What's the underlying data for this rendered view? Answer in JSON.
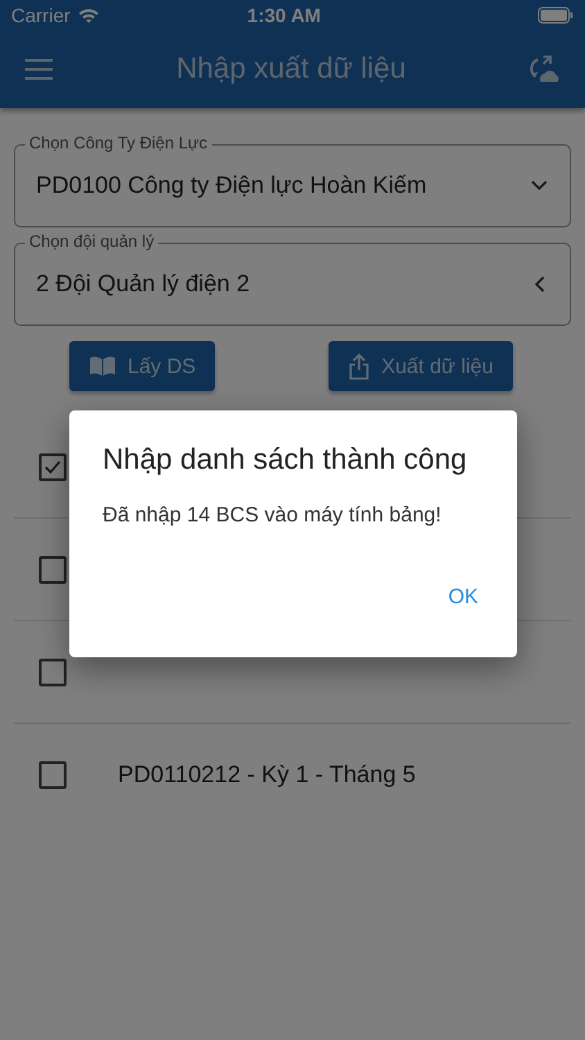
{
  "status_bar": {
    "carrier": "Carrier",
    "time": "1:30 AM"
  },
  "app_bar": {
    "title": "Nhập xuất dữ liệu"
  },
  "fields": [
    {
      "label": "Chọn Công Ty Điện Lực",
      "value": "PD0100 Công ty Điện lực Hoàn Kiếm",
      "expanded": false
    },
    {
      "label": "Chọn đội quản lý",
      "value": "2 Đội Quản lý điện 2",
      "expanded": true
    }
  ],
  "buttons": [
    {
      "label": "Lấy DS",
      "kind": "book"
    },
    {
      "label": "Xuất dữ liệu",
      "kind": "share"
    }
  ],
  "rows": [
    {
      "checked": true
    },
    {
      "checked": false
    },
    {
      "checked": false
    },
    {
      "label": "PD0110212 - Kỳ 1 - Tháng 5",
      "checked": false
    }
  ],
  "dialog": {
    "title": "Nhập danh sách thành công",
    "message": "Đã nhập 14 BCS vào máy tính bảng!",
    "button": "OK"
  }
}
